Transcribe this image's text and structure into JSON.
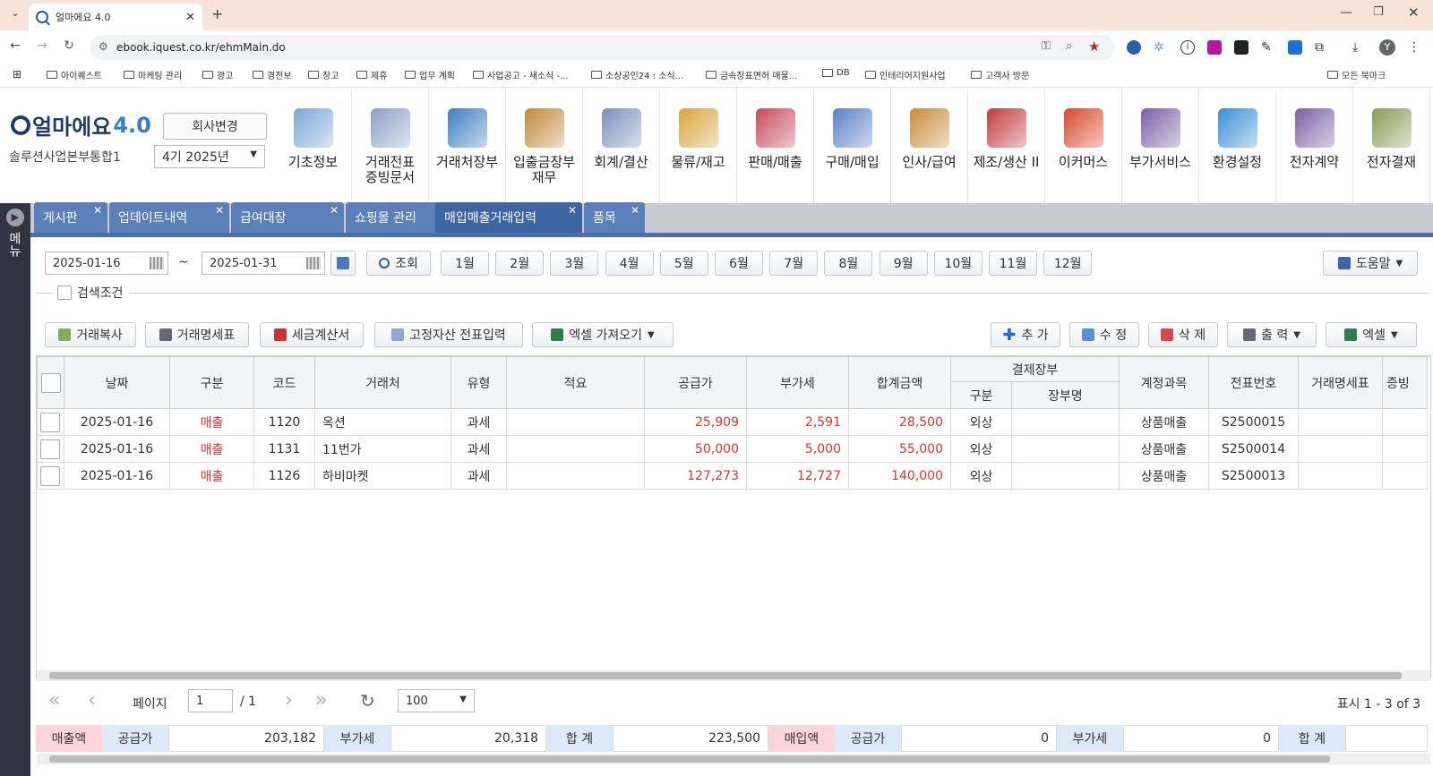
{
  "browser": {
    "tab_title": "얼마에요 4.0",
    "url": "ebook.iquest.co.kr/ehmMain.do",
    "bookmarks": [
      "아이퀘스트",
      "마케팅 관리",
      "광고",
      "경전보",
      "창고",
      "제휴",
      "업무 계획",
      "사업공고 - 새소식 -...",
      "소상공인24 : 소식...",
      "금속장표면허 매물...",
      "DB",
      "인테리어지원사업",
      "고객사 방문"
    ],
    "all_bookmarks": "모든 북마크",
    "profile": "Y"
  },
  "app": {
    "logo": "얼마에요",
    "logo_ver": "4.0",
    "company": "솔루션사업본부통합1",
    "change_company": "회사변경",
    "period": "4기 2025년",
    "menus": [
      "기초정보",
      "거래전표\n증빙문서",
      "거래처장부",
      "입출금장부\n재무",
      "회계/결산",
      "물류/재고",
      "판매/매출",
      "구매/매입",
      "인사/급여",
      "제조/생산 II",
      "이커머스",
      "부가서비스",
      "환경설정",
      "전자계약",
      "전자결재"
    ],
    "side_label": "메뉴"
  },
  "tabs": [
    "게시판",
    "업데이트내역",
    "급여대장",
    "쇼핑몰 관리",
    "매입매출거래입력",
    "품목"
  ],
  "filter": {
    "date_from": "2025-01-16",
    "tilde": "~",
    "date_to": "2025-01-31",
    "search": "조회",
    "months": [
      "1월",
      "2월",
      "3월",
      "4월",
      "5월",
      "6월",
      "7월",
      "8월",
      "9월",
      "10월",
      "11월",
      "12월"
    ],
    "help": "도움말",
    "condition": "검색조건"
  },
  "toolbar": {
    "copy": "거래복사",
    "statement": "거래명세표",
    "tax_invoice": "세금계산서",
    "asset_slip": "고정자산 전표입력",
    "excel_import": "엑셀 가져오기",
    "add": "추 가",
    "edit": "수 정",
    "delete": "삭 제",
    "print": "출 력",
    "excel": "엑셀"
  },
  "grid": {
    "headers": {
      "date": "날짜",
      "type": "구분",
      "code": "코드",
      "partner": "거래처",
      "kind": "유형",
      "memo": "적요",
      "supply": "공급가",
      "vat": "부가세",
      "total": "합계금액",
      "payment": "결제장부",
      "pay_type": "구분",
      "ledger": "장부명",
      "account": "계정과목",
      "slip_no": "전표번호",
      "statement": "거래명세표",
      "evidence": "증빙"
    },
    "rows": [
      {
        "date": "2025-01-16",
        "type": "매출",
        "code": "1120",
        "partner": "옥션",
        "kind": "과세",
        "memo": "",
        "supply": "25,909",
        "vat": "2,591",
        "total": "28,500",
        "pay_type": "외상",
        "ledger": "",
        "account": "상품매출",
        "slip_no": "S2500015"
      },
      {
        "date": "2025-01-16",
        "type": "매출",
        "code": "1131",
        "partner": "11번가",
        "kind": "과세",
        "memo": "",
        "supply": "50,000",
        "vat": "5,000",
        "total": "55,000",
        "pay_type": "외상",
        "ledger": "",
        "account": "상품매출",
        "slip_no": "S2500014"
      },
      {
        "date": "2025-01-16",
        "type": "매출",
        "code": "1126",
        "partner": "하비마켓",
        "kind": "과세",
        "memo": "",
        "supply": "127,273",
        "vat": "12,727",
        "total": "140,000",
        "pay_type": "외상",
        "ledger": "",
        "account": "상품매출",
        "slip_no": "S2500013"
      }
    ]
  },
  "pager": {
    "page_label": "페이지",
    "page": "1",
    "of": "/ 1",
    "size": "100",
    "summary": "표시 1 - 3 of 3"
  },
  "totals": {
    "sales_label": "매출액",
    "supply_label": "공급가",
    "sales_supply": "203,182",
    "vat_label": "부가세",
    "sales_vat": "20,318",
    "sum_label": "합 계",
    "sales_total": "223,500",
    "purchase_label": "매입액",
    "purchase_supply": "0",
    "purchase_vat": "0"
  },
  "colors": {
    "accent": "#3d64a3",
    "sales_red": "#e23030",
    "total_pink": "#fbd4dc",
    "total_blue": "#dbe9f8"
  }
}
